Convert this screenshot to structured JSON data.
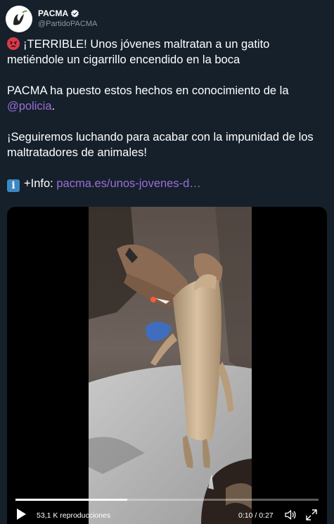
{
  "account": {
    "display_name": "PACMA",
    "handle": "@PartidoPACMA"
  },
  "tweet": {
    "line1": "¡TERRIBLE! Unos jóvenes maltratan a un gatito metiéndole un cigarrillo encendido en la boca",
    "line2": "PACMA ha puesto estos hechos en conocimiento de la",
    "mention": "@policia",
    "mention_suffix": ".",
    "line3": "¡Seguiremos luchando para acabar con la impunidad de los maltratadores de animales!",
    "info_label": "+Info:",
    "info_link": "pacma.es/unos-jovenes-d…"
  },
  "icons": {
    "angry": "angry-face-emoji-icon",
    "info": "information-emoji-icon",
    "verified": "verified-badge-icon",
    "play": "play-icon",
    "volume": "volume-icon",
    "fullscreen": "fullscreen-icon"
  },
  "video": {
    "views": "53,1 K reproducciones",
    "current_time": "0:10",
    "duration": "0:27",
    "time_separator": " / ",
    "progress_fraction": 0.37
  },
  "colors": {
    "background": "#15202b",
    "link": "#9a6fd6",
    "secondary_text": "#8899a6",
    "verified": "#ffffff"
  }
}
